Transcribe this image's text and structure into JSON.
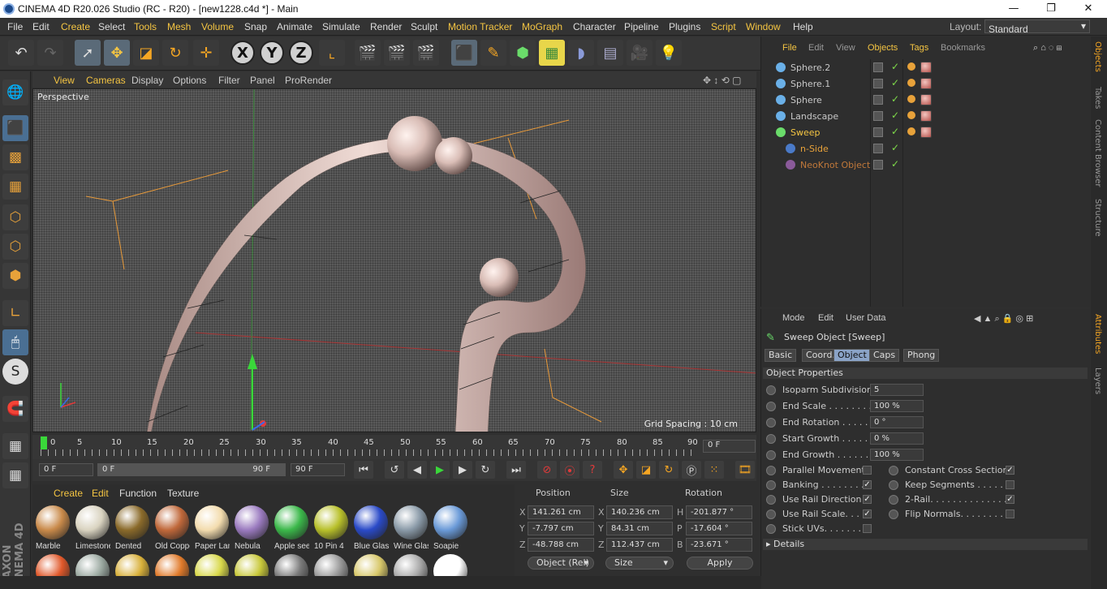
{
  "window": {
    "title": "CINEMA 4D R20.026 Studio (RC - R20) - [new1228.c4d *] - Main",
    "minimize": "—",
    "maximize": "❐",
    "close": "✕"
  },
  "menu": [
    "File",
    "Edit",
    "Create",
    "Select",
    "Tools",
    "Mesh",
    "Volume",
    "Snap",
    "Animate",
    "Simulate",
    "Render",
    "Sculpt",
    "Motion Tracker",
    "MoGraph",
    "Character",
    "Pipeline",
    "Plugins",
    "Script",
    "Window",
    "Help"
  ],
  "layout": {
    "label": "Layout:",
    "value": "Standard"
  },
  "viewport": {
    "menu": [
      "View",
      "Cameras",
      "Display",
      "Options",
      "Filter",
      "Panel",
      "ProRender"
    ],
    "camera_label": "Perspective",
    "grid_spacing": "Grid Spacing : 10 cm"
  },
  "timeline": {
    "ticks": [
      "0",
      "5",
      "10",
      "15",
      "20",
      "25",
      "30",
      "35",
      "40",
      "45",
      "50",
      "55",
      "60",
      "65",
      "70",
      "75",
      "80",
      "85",
      "90"
    ],
    "current_frame": "0 F"
  },
  "transport": {
    "start": "0 F",
    "range_start": "0 F",
    "range_end": "90 F",
    "end": "90 F"
  },
  "materials": {
    "menu": [
      "Create",
      "Edit",
      "Function",
      "Texture"
    ],
    "row1": [
      {
        "name": "Marble",
        "color": "#c98a4a"
      },
      {
        "name": "Limestone",
        "color": "#d9d3c0"
      },
      {
        "name": "Dented",
        "color": "#8a6a2a"
      },
      {
        "name": "Old Copper",
        "color": "#c0683a"
      },
      {
        "name": "Paper Lamp",
        "color": "#f3dcae"
      },
      {
        "name": "Nebula",
        "color": "#9a7abf"
      },
      {
        "name": "Apple seed",
        "color": "#3bb84a"
      },
      {
        "name": "10 Pin 4",
        "color": "#b8c02a"
      },
      {
        "name": "Blue Glass",
        "color": "#2a4ac8"
      },
      {
        "name": "Wine Glass",
        "color": "#8a9aa8"
      },
      {
        "name": "Soapie",
        "color": "#6a9ad8"
      }
    ],
    "row2_colors": [
      "#e0582a",
      "#9aa8a0",
      "#d8b03a",
      "#e07a2a",
      "#d8d84a",
      "#c8c83a",
      "#7a7a7a",
      "#999999",
      "#d8c86a",
      "#aaaaaa",
      "#ffffff"
    ]
  },
  "coords": {
    "headers": {
      "position": "Position",
      "size": "Size",
      "rotation": "Rotation"
    },
    "rows": [
      {
        "pl": "X",
        "pv": "141.261 cm",
        "sl": "X",
        "sv": "140.236 cm",
        "rl": "H",
        "rv": "-201.877 °"
      },
      {
        "pl": "Y",
        "pv": "-7.797 cm",
        "sl": "Y",
        "sv": "84.31 cm",
        "rl": "P",
        "rv": "-17.604 °"
      },
      {
        "pl": "Z",
        "pv": "-48.788 cm",
        "sl": "Z",
        "sv": "112.437 cm",
        "rl": "B",
        "rv": "-23.671 °"
      }
    ],
    "mode": "Object (Rel)",
    "size_mode": "Size",
    "apply": "Apply"
  },
  "objects": {
    "menu": [
      "File",
      "Edit",
      "View",
      "Objects",
      "Tags",
      "Bookmarks"
    ],
    "items": [
      {
        "name": "Sphere.2",
        "indent": 0,
        "color": "#c8c8c8",
        "icon": "#6ab0e8",
        "tag": true
      },
      {
        "name": "Sphere.1",
        "indent": 0,
        "color": "#c8c8c8",
        "icon": "#6ab0e8",
        "tag": true
      },
      {
        "name": "Sphere",
        "indent": 0,
        "color": "#c8c8c8",
        "icon": "#6ab0e8",
        "tag": true
      },
      {
        "name": "Landscape",
        "indent": 0,
        "color": "#c8c8c8",
        "icon": "#6ab0e8",
        "tag": true
      },
      {
        "name": "Sweep",
        "indent": 0,
        "color": "#f5c542",
        "icon": "#6adc6a",
        "tag": true
      },
      {
        "name": "n-Side",
        "indent": 1,
        "color": "#e8a23a",
        "icon": "#4a7ac8",
        "tag": false
      },
      {
        "name": "NeoKnot Object",
        "indent": 1,
        "color": "#c0783a",
        "icon": "#8a5a9a",
        "tag": false
      }
    ]
  },
  "side_tabs": [
    "Objects",
    "Takes",
    "Content Browser",
    "Structure",
    "Attributes",
    "Layers"
  ],
  "attributes": {
    "menu": [
      "Mode",
      "Edit",
      "User Data"
    ],
    "object_title": "Sweep Object [Sweep]",
    "tabs": [
      "Basic",
      "Coord.",
      "Object",
      "Caps",
      "Phong"
    ],
    "active_tab": "Object",
    "section": "Object Properties",
    "fields": [
      {
        "label": "Isoparm Subdivision",
        "value": "5"
      },
      {
        "label": "End Scale . . . . . . . . .",
        "value": "100 %"
      },
      {
        "label": "End Rotation . . . . . .",
        "value": "0 °"
      },
      {
        "label": "Start Growth . . . . . .",
        "value": "0 %"
      },
      {
        "label": "End Growth . . . . . . .",
        "value": "100 %"
      }
    ],
    "left_checks": [
      {
        "label": "Parallel Movement",
        "checked": false
      },
      {
        "label": "Banking . . . . . . . . .",
        "checked": true
      },
      {
        "label": "Use Rail Direction",
        "checked": true
      },
      {
        "label": "Use Rail Scale. . . .",
        "checked": true
      },
      {
        "label": "Stick UVs. . . . . . . .",
        "checked": false
      }
    ],
    "right_checks": [
      {
        "label": "Constant Cross Section",
        "checked": true
      },
      {
        "label": "Keep Segments . . . . . .",
        "checked": false
      },
      {
        "label": "2-Rail. . . . . . . . . . . . . .",
        "checked": true
      },
      {
        "label": "Flip Normals. . . . . . . . .",
        "checked": false
      }
    ],
    "details": "Details"
  }
}
